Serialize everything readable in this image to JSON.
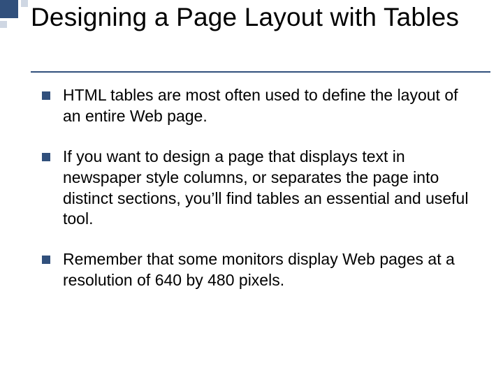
{
  "title": "Designing a Page Layout with Tables",
  "bullets": [
    "HTML tables are most often used to define the layout of an entire Web page.",
    "If you want to design a page that displays text in newspaper style columns, or separates the page into distinct sections, you’ll find tables an essential and useful tool.",
    "Remember that some monitors display Web pages at a resolution of 640 by 480 pixels."
  ]
}
